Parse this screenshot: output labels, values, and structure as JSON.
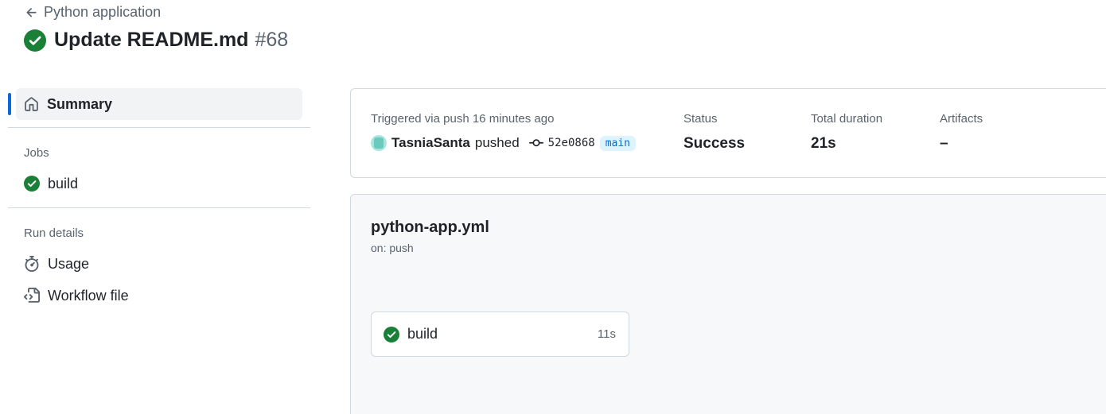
{
  "header": {
    "back_label": "Python application",
    "title": "Update README.md",
    "run_number": "#68"
  },
  "sidebar": {
    "summary_label": "Summary",
    "jobs_title": "Jobs",
    "jobs": [
      {
        "label": "build",
        "status": "success"
      }
    ],
    "run_details_title": "Run details",
    "usage_label": "Usage",
    "workflow_file_label": "Workflow file"
  },
  "summary": {
    "trigger_text": "Triggered via push 16 minutes ago",
    "user": "TasniaSanta",
    "action": "pushed",
    "commit_sha": "52e0868",
    "branch": "main",
    "status_label": "Status",
    "status_value": "Success",
    "duration_label": "Total duration",
    "duration_value": "21s",
    "artifacts_label": "Artifacts",
    "artifacts_value": "–"
  },
  "workflow": {
    "file_name": "python-app.yml",
    "trigger": "on: push",
    "jobs": [
      {
        "name": "build",
        "duration": "11s",
        "status": "success"
      }
    ]
  },
  "colors": {
    "success": "#1a7f37",
    "accent": "#0969da",
    "muted": "#59636e",
    "border": "#d1d9e0",
    "panel_bg": "#f6f8fa"
  },
  "icons": [
    "arrow-left-icon",
    "check-circle-icon",
    "home-icon",
    "stopwatch-icon",
    "file-code-icon",
    "git-commit-icon"
  ]
}
